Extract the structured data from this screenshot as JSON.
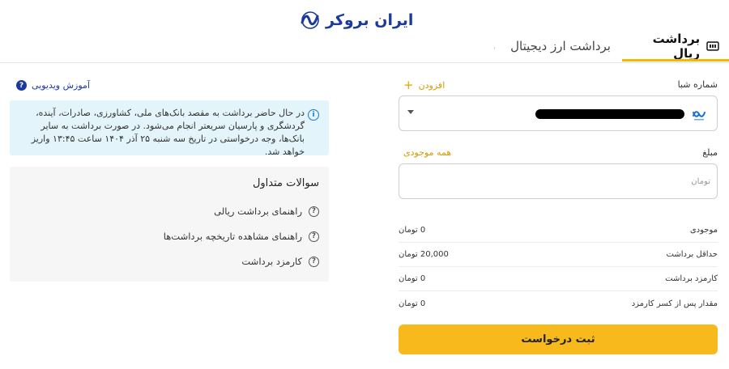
{
  "logo": {
    "text": "ایران بروکر",
    "icon": "chart-wave-icon",
    "color": "#1b3a9c"
  },
  "tabs": {
    "rial": {
      "label": "برداشت ریال",
      "icon": "banknote-icon",
      "active": true
    },
    "crypto": {
      "label": "برداشت ارز دیجیتال",
      "icon": "bitcoin-icon",
      "active": false
    }
  },
  "left": {
    "video_link": "آموزش ویدیویی",
    "info": "در حال حاضر برداشت به مقصد بانک‌های ملی، کشاورزی، صادرات، آینده، گردشگری و پارسیان سریعتر انجام می‌شود. در صورت برداشت به سایر بانک‌ها، وجه درخواستی در تاریخ سه شنبه ۲۵ آذر ۱۴۰۴ ساعت ۱۳:۴۵ واریز خواهد شد.",
    "faq": {
      "title": "سوالات متداول",
      "items": [
        "راهنمای برداشت ریالی",
        "راهنمای مشاهده تاریخچه برداشت‌ها",
        "کارمزد برداشت"
      ]
    }
  },
  "form": {
    "iban_label": "شماره شبا",
    "add_label": "افزودن",
    "amount_label": "مبلغ",
    "all_balance_label": "همه موجودی",
    "amount_placeholder": "تومان",
    "rows": [
      {
        "label": "موجودی",
        "value": "0 تومان"
      },
      {
        "label": "حداقل برداشت",
        "value": "20,000 تومان"
      },
      {
        "label": "کارمزد برداشت",
        "value": "0 تومان"
      },
      {
        "label": "مقدار پس از کسر کارمزد",
        "value": "0 تومان"
      }
    ],
    "submit_label": "ثبت درخواست"
  },
  "colors": {
    "accent": "#f7b91b",
    "brand": "#1b3a9c",
    "info_bg": "#e3f4fb"
  }
}
